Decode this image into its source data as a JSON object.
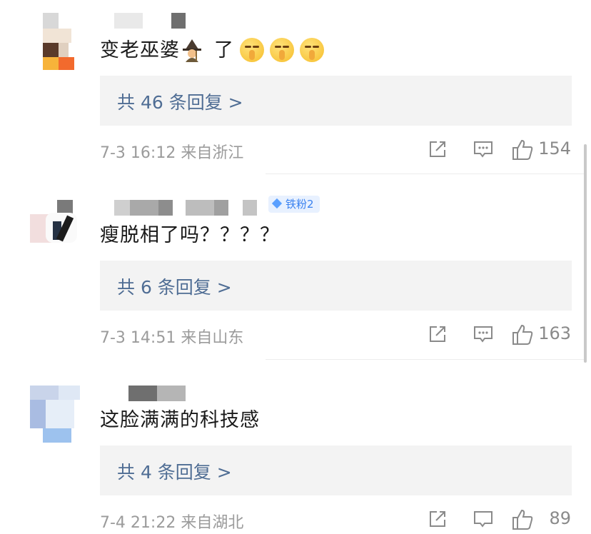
{
  "comments": [
    {
      "text": "变老巫婆",
      "text_suffix": "了",
      "emojis": [
        "witch-emoji",
        "shushing-face-emoji",
        "shushing-face-emoji",
        "shushing-face-emoji"
      ],
      "replies": "共 46 条回复 >",
      "meta": "7-3 16:12  来自浙江",
      "likes": "154"
    },
    {
      "text": "瘦脱相了吗？？？？",
      "badge": "铁粉2",
      "replies": "共 6 条回复 >",
      "meta": "7-3 14:51  来自山东",
      "likes": "163"
    },
    {
      "text": "这脸满满的科技感",
      "replies": "共 4 条回复 >",
      "meta": "7-4 21:22  来自湖北",
      "likes": "89"
    }
  ],
  "colors": {
    "link": "#4f6d94",
    "meta": "#9b9b9b",
    "reply_bg": "#f3f3f3",
    "badge_text": "#3a82f0"
  },
  "icons": [
    "share-icon",
    "comment-icon",
    "like-icon"
  ]
}
